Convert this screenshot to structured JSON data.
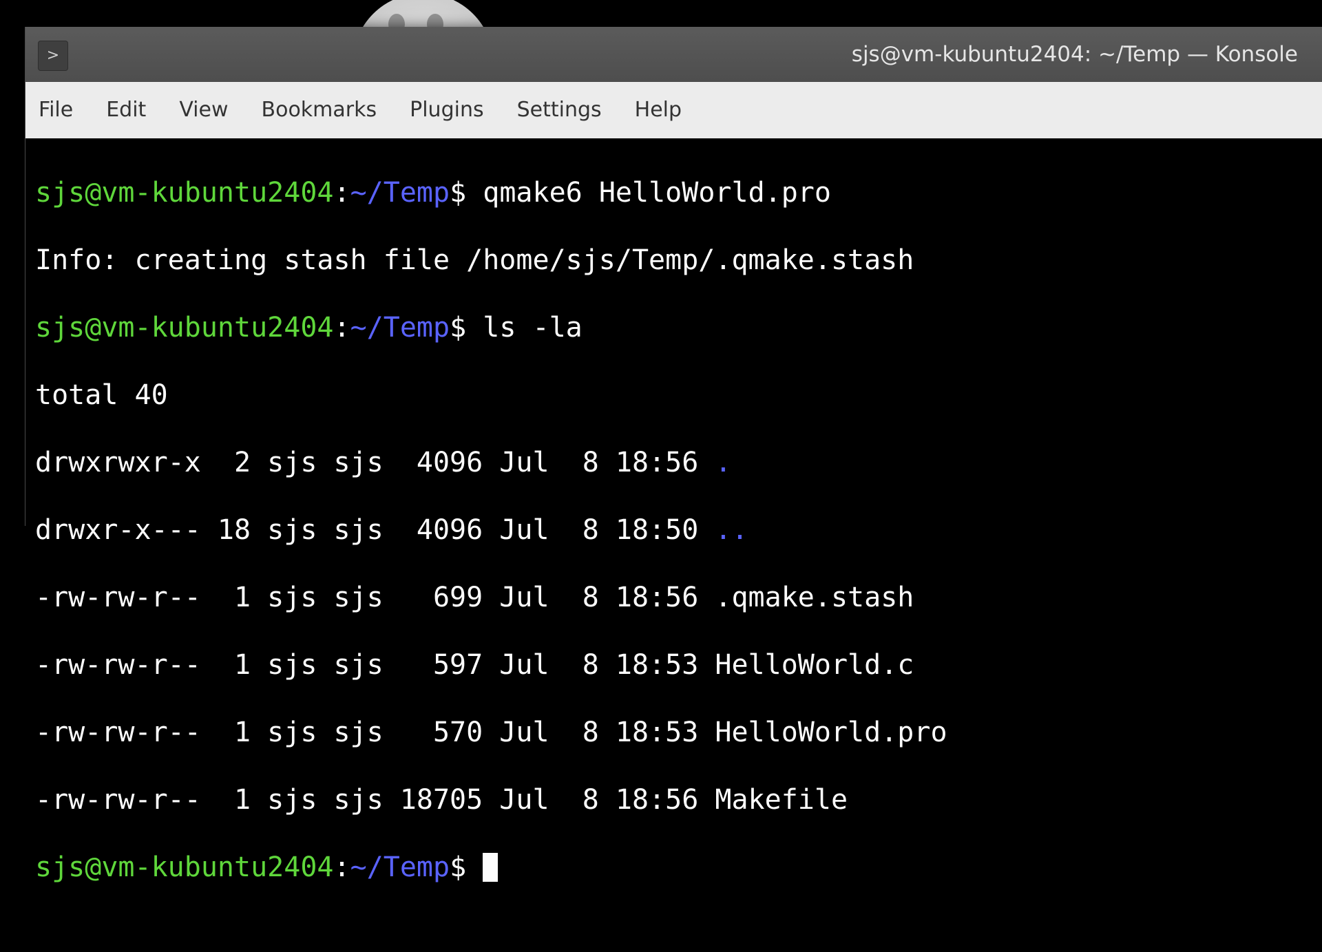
{
  "window": {
    "title": "sjs@vm-kubuntu2404: ~/Temp — Konsole",
    "app_icon": ">"
  },
  "menu": [
    "File",
    "Edit",
    "View",
    "Bookmarks",
    "Plugins",
    "Settings",
    "Help"
  ],
  "prompt": {
    "user_host": "sjs@vm-kubuntu2404",
    "colon": ":",
    "path": "~/Temp",
    "suffix": "$ "
  },
  "commands": {
    "first": "qmake6 HelloWorld.pro",
    "second": "ls -la"
  },
  "output": {
    "info": "Info: creating stash file /home/sjs/Temp/.qmake.stash",
    "total": "total 40",
    "rows": [
      {
        "meta": "drwxrwxr-x  2 sjs sjs  4096 Jul  8 18:56 ",
        "name": "."
      },
      {
        "meta": "drwxr-x--- 18 sjs sjs  4096 Jul  8 18:50 ",
        "name": ".."
      },
      {
        "meta": "-rw-rw-r--  1 sjs sjs   699 Jul  8 18:56 ",
        "name": ".qmake.stash"
      },
      {
        "meta": "-rw-rw-r--  1 sjs sjs   597 Jul  8 18:53 ",
        "name": "HelloWorld.c"
      },
      {
        "meta": "-rw-rw-r--  1 sjs sjs   570 Jul  8 18:53 ",
        "name": "HelloWorld.pro"
      },
      {
        "meta": "-rw-rw-r--  1 sjs sjs 18705 Jul  8 18:56 ",
        "name": "Makefile"
      }
    ]
  },
  "colors": {
    "prompt_user": "#5fd73b",
    "prompt_path": "#5a63ff",
    "text": "#fcfcfc",
    "background": "#000000"
  }
}
